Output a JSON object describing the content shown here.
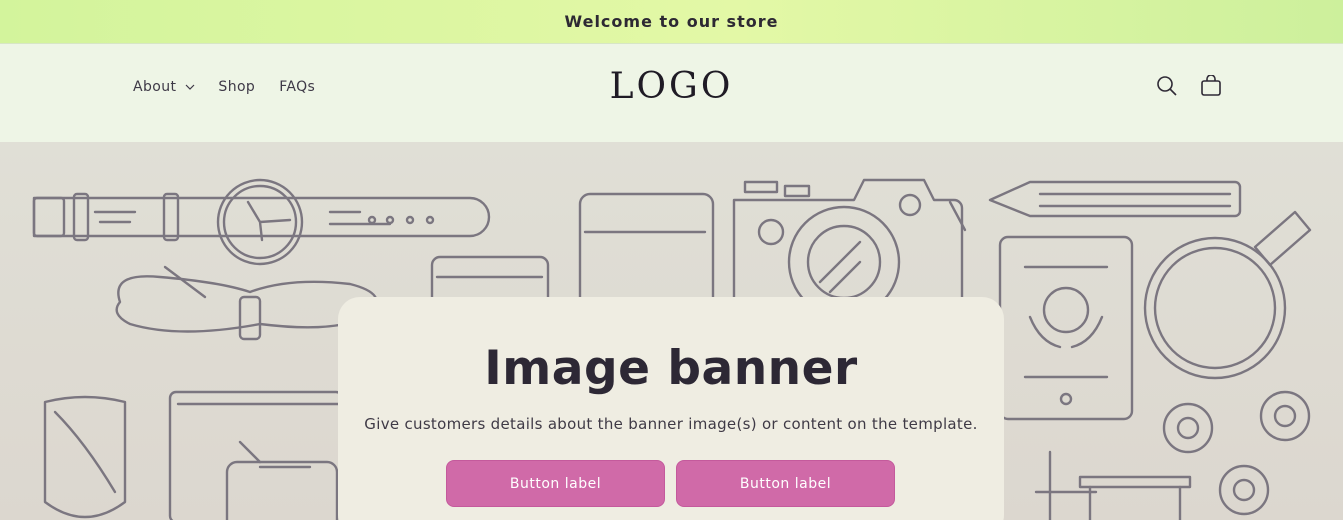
{
  "announcement": {
    "text": "Welcome to our store"
  },
  "header": {
    "nav": [
      {
        "label": "About",
        "has_dropdown": true
      },
      {
        "label": "Shop"
      },
      {
        "label": "FAQs"
      }
    ],
    "logo": "LOGO",
    "icons": [
      "search-icon",
      "cart-icon"
    ]
  },
  "banner": {
    "title": "Image banner",
    "description": "Give customers details about the banner image(s) or content on the template.",
    "buttons": [
      {
        "label": "Button label"
      },
      {
        "label": "Button label"
      }
    ],
    "colors": {
      "button": "#d06aa8",
      "background": "#dedcd3",
      "box": "#efede2"
    }
  },
  "colors": {
    "announcement": "#d9f59f",
    "header": "#eef5e6"
  }
}
